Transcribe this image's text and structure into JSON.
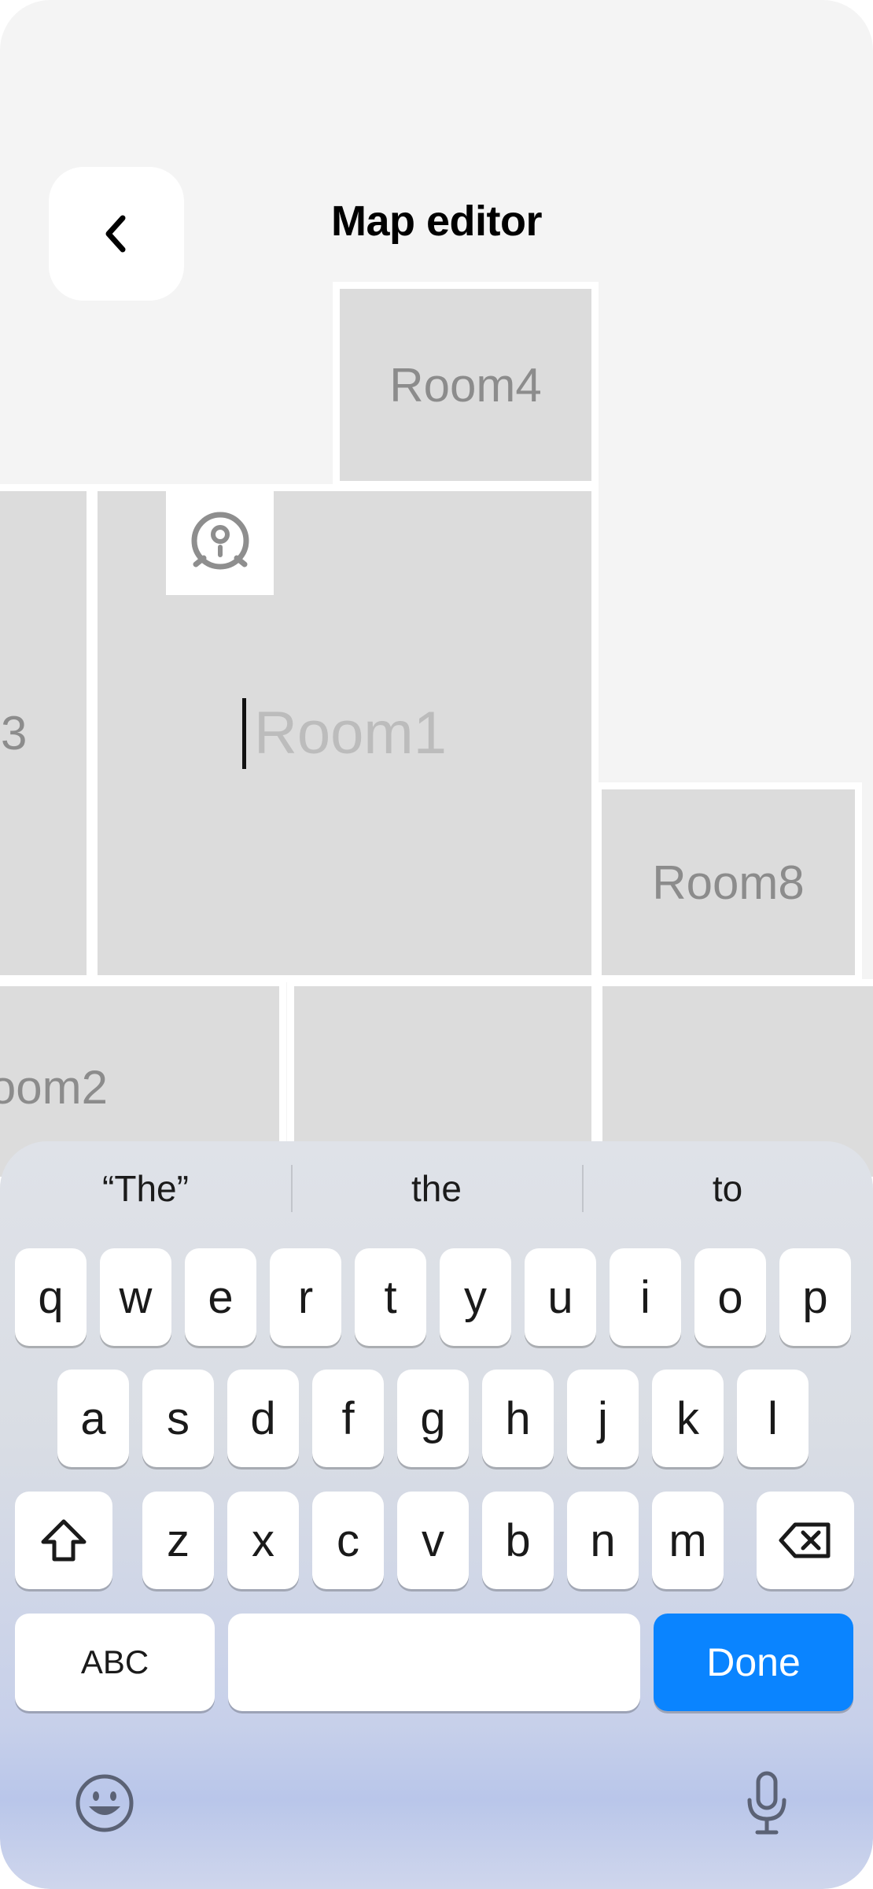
{
  "header": {
    "title": "Map editor",
    "back_icon": "chevron-left-icon"
  },
  "map": {
    "rooms": [
      {
        "id": "room4",
        "label": "Room4"
      },
      {
        "id": "room3",
        "label": "3"
      },
      {
        "id": "room1",
        "label": "Room1",
        "editing": true
      },
      {
        "id": "room8",
        "label": "Room8"
      },
      {
        "id": "room2",
        "label": "oom2"
      },
      {
        "id": "room-bottom-middle",
        "label": ""
      },
      {
        "id": "room-bottom-right",
        "label": ""
      }
    ],
    "robot_icon": "robot-vacuum-icon",
    "room_color": "#dcdcdc",
    "background_color": "#f4f4f4"
  },
  "keyboard": {
    "suggestions": [
      "“The”",
      "the",
      "to"
    ],
    "row1": [
      "q",
      "w",
      "e",
      "r",
      "t",
      "y",
      "u",
      "i",
      "o",
      "p"
    ],
    "row2": [
      "a",
      "s",
      "d",
      "f",
      "g",
      "h",
      "j",
      "k",
      "l"
    ],
    "row3": [
      "z",
      "x",
      "c",
      "v",
      "b",
      "n",
      "m"
    ],
    "abc_label": "ABC",
    "done_label": "Done",
    "done_color": "#0a84ff",
    "shift_icon": "shift-icon",
    "delete_icon": "delete-icon",
    "emoji_icon": "emoji-icon",
    "mic_icon": "microphone-icon"
  }
}
